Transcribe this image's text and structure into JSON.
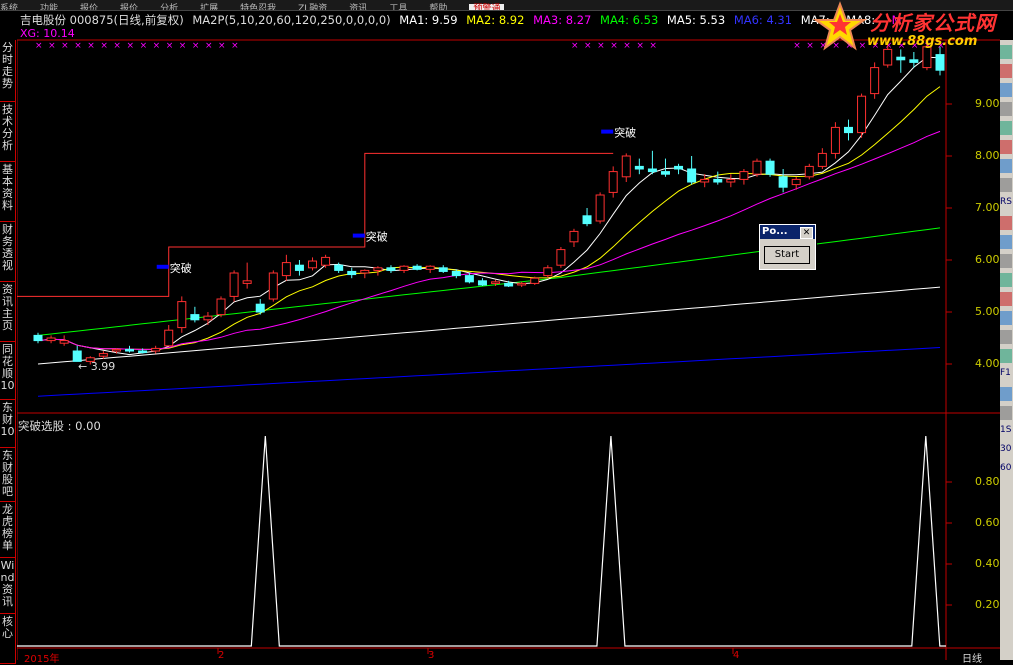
{
  "top_menu": [
    "系统",
    "功能",
    "报价",
    "报价",
    "分析",
    "扩展",
    "特色忍我",
    "ZL融资",
    "资讯",
    "工具",
    "帮助",
    "预警通"
  ],
  "header": {
    "stock": "吉电股份 000875(日线,前复权)",
    "indicator": "MA2P(5,10,20,60,120,250,0,0,0,0)",
    "ma1": "MA1: 9.59",
    "ma2": "MA2: 8.92",
    "ma3": "MA3: 8.27",
    "ma4": "MA4: 6.53",
    "ma5": "MA5: 5.53",
    "ma6": "MA6: 4.31",
    "ma7": "MA7: -",
    "ma8": "MA8: -",
    "ma9": "M"
  },
  "xg_label": "XG: 10.14",
  "sidebar": [
    "分时走势",
    "技术分析",
    "基本资料",
    "财务透视",
    "资讯主页",
    "同花顺10",
    "东财10",
    "东财股吧",
    "龙虎榜单",
    "Wind资讯",
    "核心"
  ],
  "right_panel": [
    "",
    "",
    "",
    "",
    "",
    "",
    "",
    "",
    "RS",
    "",
    "",
    "",
    "",
    "",
    "",
    "",
    "",
    "F1",
    "",
    "",
    "1S",
    "30",
    "60"
  ],
  "logo": {
    "title": "分析家公式网",
    "url": "www.88gs.com"
  },
  "popup": {
    "title": "Po...",
    "close": "✕",
    "button": "Start"
  },
  "annotations": {
    "low": "← 3.99",
    "breakout": "突破"
  },
  "sub_label": "突破选股 : 0.00",
  "price_axis": [
    "9.00",
    "8.00",
    "7.00",
    "6.00",
    "5.00",
    "4.00"
  ],
  "sub_axis": [
    "0.80",
    "0.60",
    "0.40",
    "0.20"
  ],
  "date_labels": [
    "2015年",
    "2",
    "3",
    "4"
  ],
  "period_label": "日线",
  "colors": {
    "ma1": "#ffffff",
    "ma2": "#ffff00",
    "ma3": "#ff00ff",
    "ma4": "#00ff00",
    "ma5": "#ffffff",
    "ma6": "#0000ff",
    "up": "#ff3030",
    "down": "#54ffff",
    "frame": "#c00000"
  },
  "chart_data": {
    "type": "candlestick",
    "price_min": 3.99,
    "candles": [
      [
        4.55,
        4.6,
        4.4,
        4.45
      ],
      [
        4.45,
        4.55,
        4.4,
        4.5
      ],
      [
        4.4,
        4.55,
        4.35,
        4.45
      ],
      [
        4.25,
        4.35,
        4.05,
        4.05
      ],
      [
        4.05,
        4.15,
        3.99,
        4.12
      ],
      [
        4.15,
        4.25,
        4.1,
        4.2
      ],
      [
        4.25,
        4.3,
        4.2,
        4.28
      ],
      [
        4.28,
        4.35,
        4.22,
        4.25
      ],
      [
        4.25,
        4.3,
        4.2,
        4.22
      ],
      [
        4.25,
        4.35,
        4.2,
        4.3
      ],
      [
        4.35,
        4.75,
        4.35,
        4.65
      ],
      [
        4.7,
        5.3,
        4.6,
        5.2
      ],
      [
        4.95,
        5.1,
        4.8,
        4.85
      ],
      [
        4.85,
        5.0,
        4.75,
        4.92
      ],
      [
        4.95,
        5.3,
        4.9,
        5.25
      ],
      [
        5.3,
        5.8,
        5.2,
        5.75
      ],
      [
        5.55,
        5.95,
        5.45,
        5.6
      ],
      [
        5.15,
        5.25,
        4.95,
        5.0
      ],
      [
        5.25,
        5.8,
        5.2,
        5.75
      ],
      [
        5.7,
        6.1,
        5.6,
        5.95
      ],
      [
        5.9,
        6.0,
        5.7,
        5.8
      ],
      [
        5.85,
        6.05,
        5.8,
        5.98
      ],
      [
        5.9,
        6.1,
        5.85,
        6.05
      ],
      [
        5.9,
        5.95,
        5.75,
        5.8
      ],
      [
        5.78,
        5.85,
        5.65,
        5.72
      ],
      [
        5.75,
        5.82,
        5.65,
        5.8
      ],
      [
        5.8,
        5.88,
        5.7,
        5.85
      ],
      [
        5.85,
        5.9,
        5.75,
        5.8
      ],
      [
        5.8,
        5.9,
        5.75,
        5.88
      ],
      [
        5.88,
        5.92,
        5.8,
        5.82
      ],
      [
        5.82,
        5.9,
        5.75,
        5.88
      ],
      [
        5.85,
        5.9,
        5.75,
        5.78
      ],
      [
        5.78,
        5.82,
        5.65,
        5.7
      ],
      [
        5.7,
        5.75,
        5.55,
        5.58
      ],
      [
        5.6,
        5.65,
        5.5,
        5.52
      ],
      [
        5.55,
        5.62,
        5.5,
        5.58
      ],
      [
        5.55,
        5.6,
        5.48,
        5.5
      ],
      [
        5.52,
        5.58,
        5.48,
        5.55
      ],
      [
        5.55,
        5.68,
        5.52,
        5.65
      ],
      [
        5.7,
        5.9,
        5.65,
        5.85
      ],
      [
        5.9,
        6.25,
        5.85,
        6.2
      ],
      [
        6.35,
        6.6,
        6.25,
        6.55
      ],
      [
        6.85,
        7.0,
        6.65,
        6.7
      ],
      [
        6.75,
        7.3,
        6.7,
        7.25
      ],
      [
        7.3,
        7.8,
        7.2,
        7.7
      ],
      [
        7.6,
        8.05,
        7.5,
        8.0
      ],
      [
        7.8,
        7.95,
        7.65,
        7.75
      ],
      [
        7.75,
        8.1,
        7.65,
        7.7
      ],
      [
        7.7,
        7.95,
        7.6,
        7.65
      ],
      [
        7.8,
        7.85,
        7.65,
        7.75
      ],
      [
        7.75,
        8.0,
        7.45,
        7.5
      ],
      [
        7.5,
        7.65,
        7.4,
        7.55
      ],
      [
        7.55,
        7.7,
        7.45,
        7.5
      ],
      [
        7.5,
        7.65,
        7.4,
        7.55
      ],
      [
        7.55,
        7.75,
        7.45,
        7.7
      ],
      [
        7.65,
        7.95,
        7.6,
        7.9
      ],
      [
        7.9,
        7.95,
        7.6,
        7.65
      ],
      [
        7.6,
        7.75,
        7.3,
        7.4
      ],
      [
        7.45,
        7.6,
        7.35,
        7.55
      ],
      [
        7.6,
        7.85,
        7.55,
        7.8
      ],
      [
        7.8,
        8.15,
        7.75,
        8.05
      ],
      [
        8.05,
        8.65,
        7.95,
        8.55
      ],
      [
        8.55,
        8.7,
        8.3,
        8.45
      ],
      [
        8.45,
        9.2,
        8.35,
        9.15
      ],
      [
        9.2,
        9.8,
        9.1,
        9.7
      ],
      [
        9.75,
        10.14,
        9.7,
        10.05
      ],
      [
        9.9,
        10.05,
        9.6,
        9.85
      ],
      [
        9.85,
        10.0,
        9.7,
        9.8
      ],
      [
        9.7,
        10.14,
        9.65,
        10.1
      ],
      [
        9.95,
        10.1,
        9.55,
        9.65
      ]
    ],
    "breakouts": [
      [
        9,
        5.3
      ],
      [
        22,
        6.25
      ],
      [
        28,
        8.05
      ]
    ],
    "signal_peaks_at_candle": [
      9,
      22,
      31
    ]
  }
}
